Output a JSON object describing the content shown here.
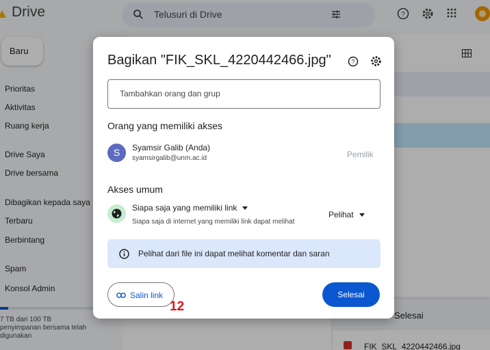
{
  "app": {
    "title": "Drive",
    "search_placeholder": "Telusuri di Drive"
  },
  "sidebar": {
    "new_label": "Baru",
    "items": [
      {
        "label": "Prioritas"
      },
      {
        "label": "Aktivitas"
      },
      {
        "label": "Ruang kerja"
      },
      {
        "label": "Drive Saya"
      },
      {
        "label": "Drive bersama"
      },
      {
        "label": "Dibagikan kepada saya"
      },
      {
        "label": "Terbaru"
      },
      {
        "label": "Berbintang"
      },
      {
        "label": "Spam"
      },
      {
        "label": "Konsol Admin"
      }
    ],
    "storage_text": "7 TB dari 100 TB",
    "storage_sub": "penyimpanan bersama telah digunakan",
    "storage_fraction": 0.07
  },
  "upload_panel": {
    "title": "Selesai",
    "file_name": "FIK_SKL_4220442466.jpg"
  },
  "dialog": {
    "title": "Bagikan \"FIK_SKL_4220442466.jpg\"",
    "add_placeholder": "Tambahkan orang dan grup",
    "people_heading": "Orang yang memiliki akses",
    "person": {
      "initial": "S",
      "name": "Syamsir Galib (Anda)",
      "email": "syamsirgalib@unm.ac.id",
      "role": "Pemilik"
    },
    "general_heading": "Akses umum",
    "access": {
      "selected": "Siapa saja yang memiliki link",
      "description": "Siapa saja di internet yang memiliki link dapat melihat",
      "role": "Pelihat"
    },
    "info_text": "Pelihat dari file ini dapat melihat komentar dan saran",
    "copy_link_label": "Salin link",
    "done_label": "Selesai"
  },
  "annotation": {
    "marker": "12"
  },
  "colors": {
    "accent": "#0b57d0",
    "avatar": "#5c6bc0",
    "info_bg": "#dbe7fb",
    "globe_bg": "#c4eed0",
    "marker": "#e0141a"
  }
}
